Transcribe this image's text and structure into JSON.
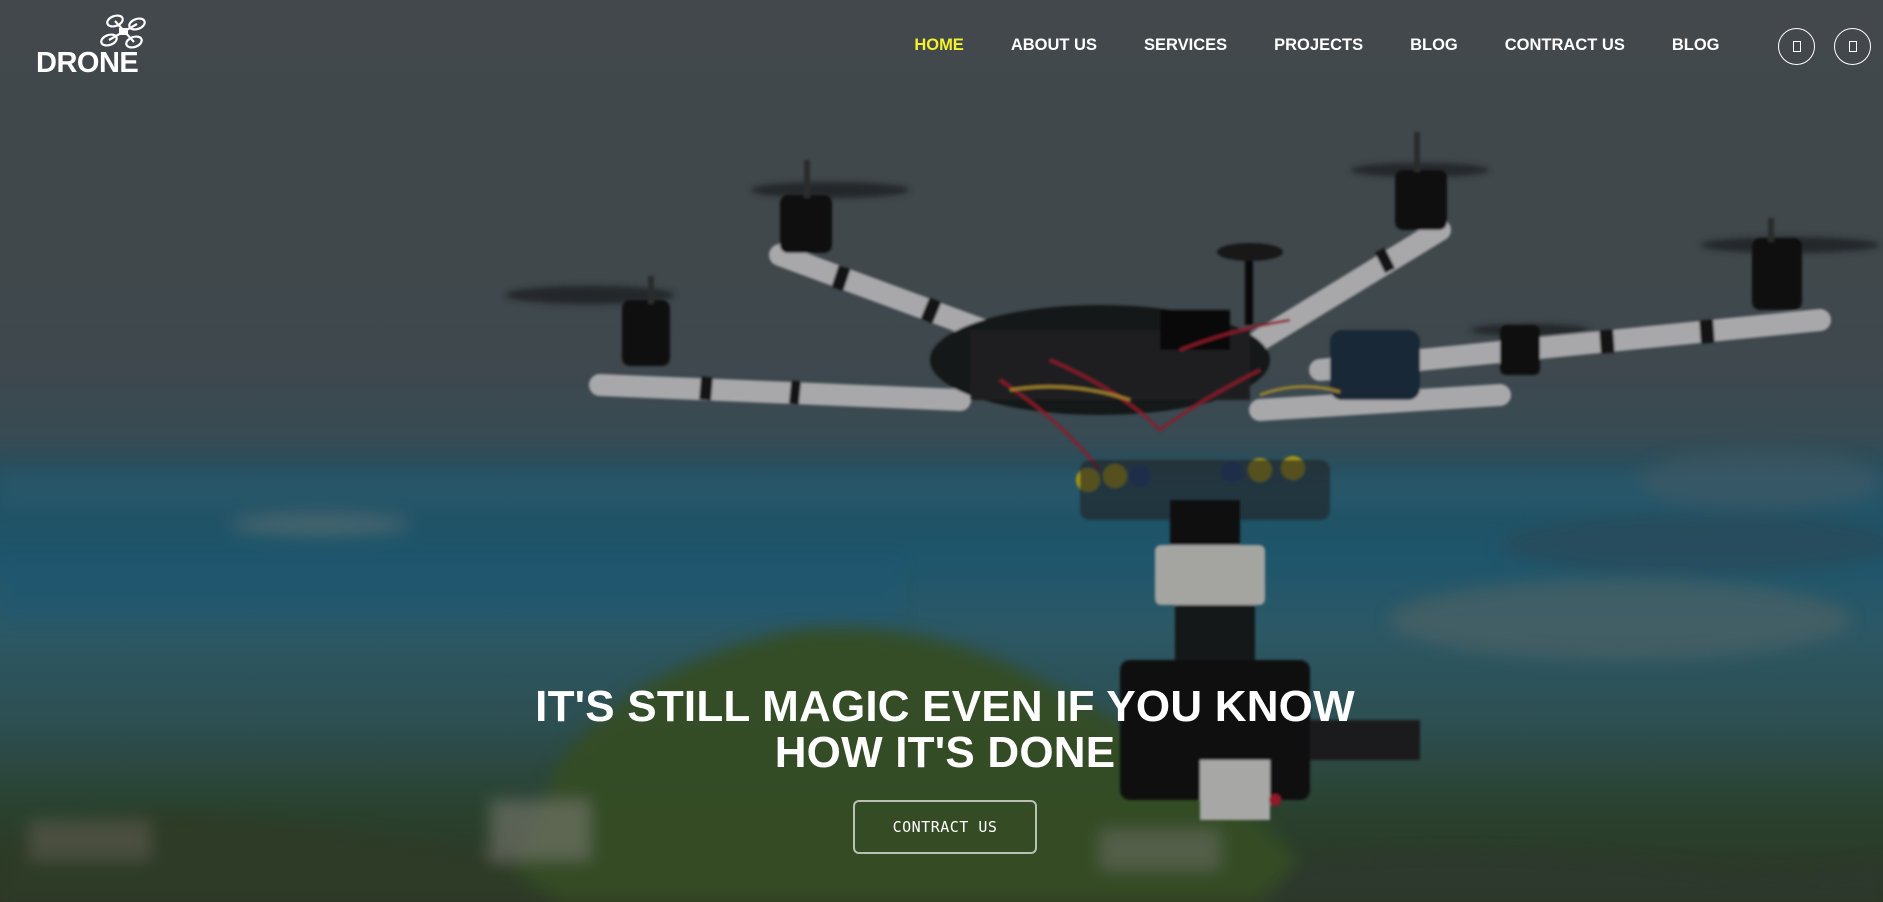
{
  "brand": {
    "logo_text": "DRONE",
    "logo_icon": "drone-icon"
  },
  "nav": {
    "items": [
      {
        "label": "HOME",
        "active": true
      },
      {
        "label": "ABOUT US",
        "active": false
      },
      {
        "label": "SERVICES",
        "active": false
      },
      {
        "label": "PROJECTS",
        "active": false
      },
      {
        "label": "BLOG",
        "active": false
      },
      {
        "label": "CONTRACT US",
        "active": false
      },
      {
        "label": "BLOG",
        "active": false
      }
    ],
    "active_color": "#f2f230",
    "icon_buttons": [
      "search-icon",
      "cart-icon"
    ]
  },
  "hero": {
    "heading_line1": "IT'S STILL MAGIC EVEN IF YOU KNOW",
    "heading_line2": "HOW IT'S DONE",
    "cta_label": "CONTRACT US",
    "background_image": "hexacopter-drone-over-coast"
  }
}
